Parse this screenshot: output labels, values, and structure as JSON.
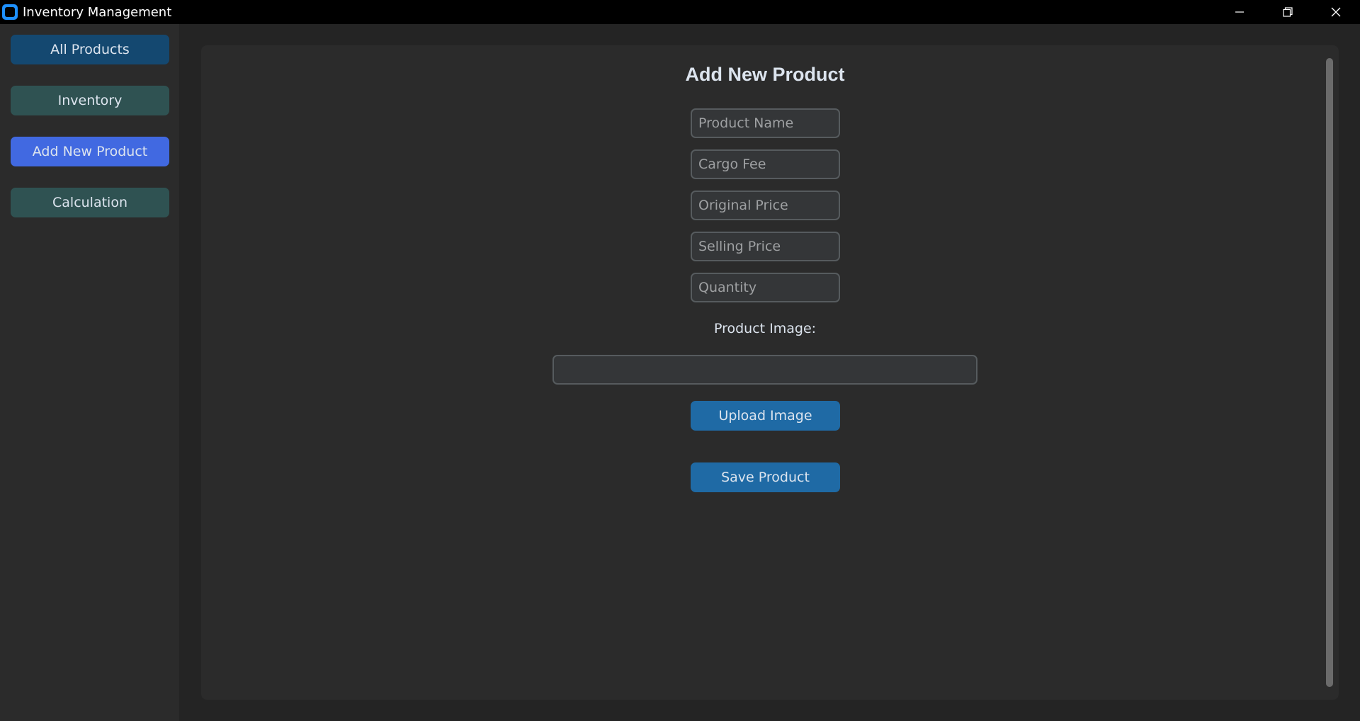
{
  "window": {
    "title": "Inventory Management",
    "icon": "app-icon",
    "controls": [
      "minimize-icon",
      "restore-icon",
      "close-icon"
    ]
  },
  "sidebar": {
    "items": [
      {
        "label": "All Products",
        "color": "#144870"
      },
      {
        "label": "Inventory",
        "color": "#2f5252"
      },
      {
        "label": "Add New Product",
        "color": "#4169e1",
        "active": true
      },
      {
        "label": "Calculation",
        "color": "#2f5252"
      }
    ]
  },
  "form": {
    "title": "Add New Product",
    "fields": [
      {
        "placeholder": "Product Name",
        "value": ""
      },
      {
        "placeholder": "Cargo Fee",
        "value": ""
      },
      {
        "placeholder": "Original Price",
        "value": ""
      },
      {
        "placeholder": "Selling Price",
        "value": ""
      },
      {
        "placeholder": "Quantity",
        "value": ""
      }
    ],
    "image_label": "Product Image:",
    "image_path": "",
    "upload_label": "Upload Image",
    "save_label": "Save Product"
  },
  "colors": {
    "background": "#242424",
    "frame": "#2b2b2b",
    "button_primary": "#1f6aa5",
    "entry_bg": "#343638",
    "entry_border": "#565b5e"
  }
}
